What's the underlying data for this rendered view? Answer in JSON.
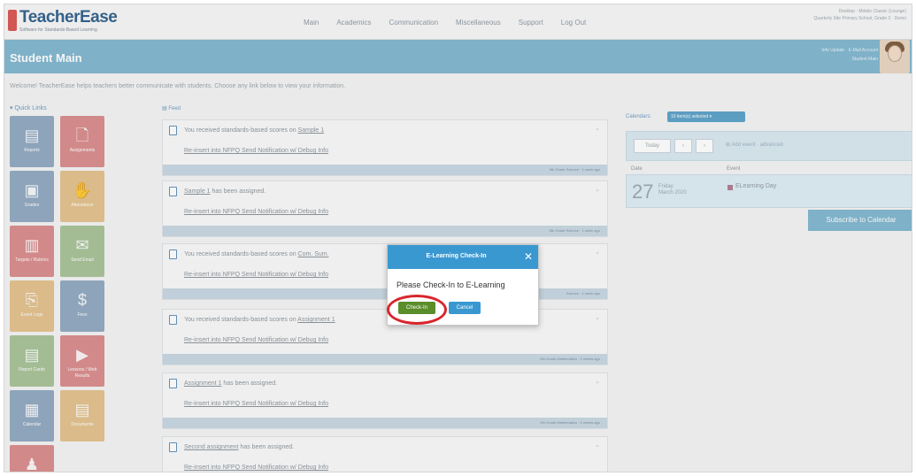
{
  "app": {
    "logo_name": "TeacherEase",
    "logo_tagline": "Software for Standards-Based Learning",
    "top_right_line1": "Desktop · Mobile Classic (Lounge)",
    "top_right_line2": "Quarterly Site Primary School, Grade 3 · Demo"
  },
  "nav": {
    "items": [
      "Main",
      "Academics",
      "Communication",
      "Miscellaneous",
      "Support",
      "Log Out"
    ]
  },
  "header": {
    "title": "Student Main",
    "user_line1": "Info Update · E-Mail Account",
    "user_line2": "Student Main"
  },
  "welcome": "Welcome! TeacherEase helps teachers better communicate with students. Choose any link below to view your information.",
  "quick_links": {
    "title": "Quick Links",
    "tiles": [
      {
        "label": "Reports",
        "icon": "▤",
        "color": "#8fa8c0"
      },
      {
        "label": "Assignments",
        "icon": "🗋",
        "color": "#d98a8a"
      },
      {
        "label": "Grades",
        "icon": "▣",
        "color": "#8fa8c0"
      },
      {
        "label": "Attendance",
        "icon": "✋",
        "color": "#e2c08a"
      },
      {
        "label": "Targets / Rubrics",
        "icon": "▥",
        "color": "#d98a8a"
      },
      {
        "label": "Send Email",
        "icon": "✉",
        "color": "#a7c296"
      },
      {
        "label": "Event Logs",
        "icon": "⎘",
        "color": "#e2c08a"
      },
      {
        "label": "Fees",
        "icon": "$",
        "color": "#8fa8c0"
      },
      {
        "label": "Report Cards",
        "icon": "▤",
        "color": "#a7c296"
      },
      {
        "label": "Lessons / Web Results",
        "icon": "▶",
        "color": "#d98a8a"
      },
      {
        "label": "Calendar",
        "icon": "▦",
        "color": "#8fa8c0"
      },
      {
        "label": "Documents",
        "icon": "▤",
        "color": "#e2c08a"
      },
      {
        "label": "",
        "icon": "♟",
        "color": "#d98a8a"
      }
    ]
  },
  "feed": {
    "title": "Feed",
    "link_text": "Re-insert into NFPQ Send Notification w/ Debug Info",
    "items": [
      {
        "prefix": "You received standards-based scores on ",
        "link": "Sample 1",
        "suffix": "",
        "footer": "5th Grade Science · 1 week ago"
      },
      {
        "prefix": "",
        "link": "Sample 1",
        "suffix": " has been assigned.",
        "footer": "5th Grade Science · 1 week ago"
      },
      {
        "prefix": "You received standards-based scores on ",
        "link": "Com. Sum.",
        "suffix": "",
        "footer": "Science · 1 week ago"
      },
      {
        "prefix": "You received standards-based scores on ",
        "link": "Assignment 1",
        "suffix": "",
        "footer": "5th Grade Mathematics · 2 weeks ago"
      },
      {
        "prefix": "",
        "link": "Assignment 1",
        "suffix": " has been assigned.",
        "footer": "5th Grade Mathematics · 2 weeks ago"
      },
      {
        "prefix": "",
        "link": "Second assignment",
        "suffix": " has been assigned.",
        "footer": ""
      }
    ]
  },
  "calendar": {
    "label": "Calendars:",
    "selected": "10 item(s) selected",
    "today_btn": "Today",
    "prev_btn": "‹",
    "next_btn": "›",
    "add_event": "Add event · advanced",
    "col_date": "Date",
    "col_event": "Event",
    "day_number": "27",
    "day_name": "Friday",
    "month_year": "March 2020",
    "event_name": "ELearning Day",
    "subscribe": "Subscribe to Calendar"
  },
  "modal": {
    "title": "E-Learning Check-In",
    "message": "Please Check-In to E-Learning",
    "checkin_label": "Check-In",
    "cancel_label": "Cancel",
    "close_glyph": "✕"
  }
}
